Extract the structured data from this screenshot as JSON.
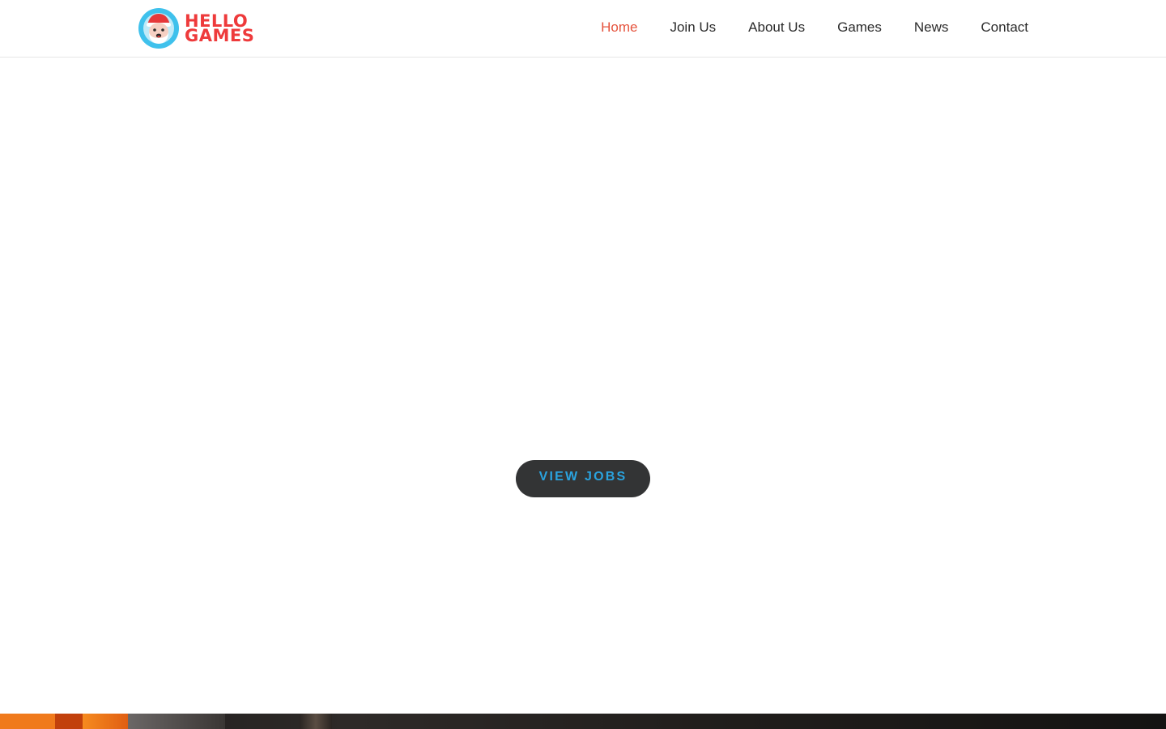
{
  "brand": {
    "line1": "HELLO",
    "line2": "GAMES",
    "color": "#ee3a3b"
  },
  "nav": {
    "items": [
      {
        "label": "Home",
        "active": true
      },
      {
        "label": "Join Us",
        "active": false
      },
      {
        "label": "About Us",
        "active": false
      },
      {
        "label": "Games",
        "active": false
      },
      {
        "label": "News",
        "active": false
      },
      {
        "label": "Contact",
        "active": false
      }
    ],
    "active_color": "#e5533d"
  },
  "cta": {
    "label": "VIEW JOBS",
    "text_color": "#2aa3df",
    "background": "#333435"
  },
  "icons": {
    "logo": "santa-face-logo-icon"
  }
}
